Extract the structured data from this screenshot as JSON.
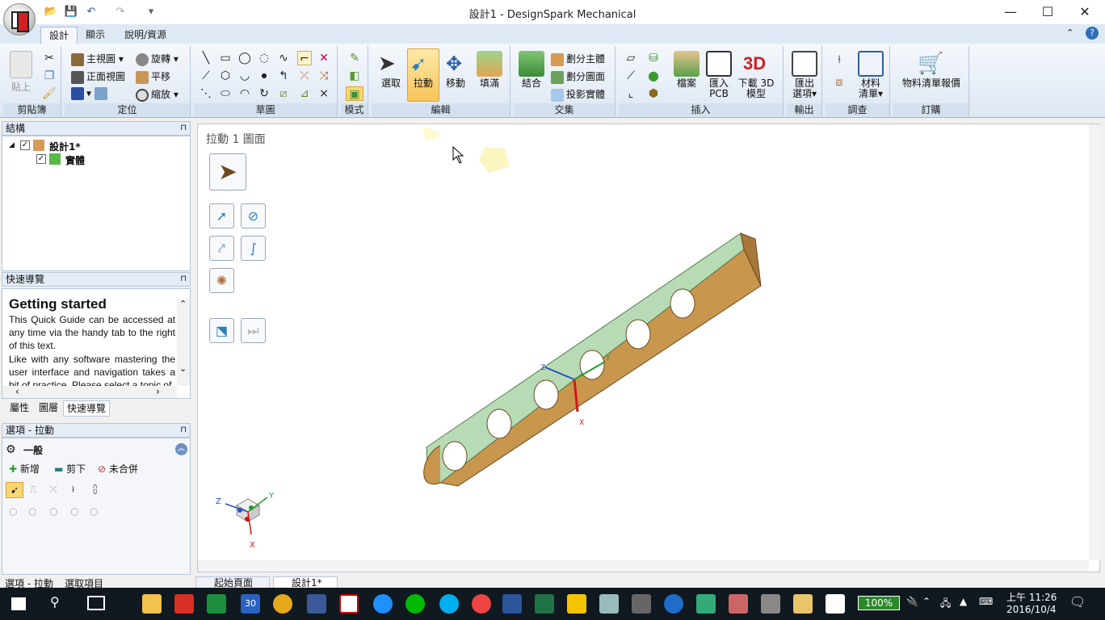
{
  "window": {
    "title": "設計1 - DesignSpark Mechanical",
    "minimize": "—",
    "maximize": "☐",
    "close": "✕"
  },
  "ribbon_tabs": [
    "設計",
    "顯示",
    "說明/資源"
  ],
  "clipboard": {
    "paste": "貼上",
    "label": "剪貼簿"
  },
  "orient": {
    "home_view": "主視圖",
    "front_view": "正面視圖",
    "rotate": "旋轉",
    "pan": "平移",
    "zoom": "縮放",
    "label": "定位"
  },
  "sketch": {
    "label": "草圖"
  },
  "mode": {
    "label": "模式"
  },
  "edit": {
    "select": "選取",
    "pull": "拉動",
    "move": "移動",
    "fill": "填滿",
    "label": "編輯"
  },
  "intersect": {
    "combine": "結合",
    "split_body": "劃分主體",
    "split_face": "劃分圖面",
    "project": "投影實體",
    "label": "交集"
  },
  "insert": {
    "file": "檔案",
    "import_pcb_1": "匯入",
    "import_pcb_2": "PCB",
    "download_3d_1": "下載 3D",
    "download_3d_2": "模型",
    "label": "插入"
  },
  "output": {
    "export_1": "匯出",
    "export_2": "選項",
    "label": "輸出"
  },
  "inspect": {
    "bom_1": "材料",
    "bom_2": "清單",
    "label": "調查"
  },
  "order": {
    "bom_quote": "物料清單報價",
    "label": "訂購"
  },
  "structure": {
    "title": "結構",
    "root": "設計1*",
    "child": "實體"
  },
  "quick_guide": {
    "title": "快速導覽",
    "heading": "Getting started",
    "p1": "This Quick Guide can be accessed at any time via the handy tab to the right of this text.",
    "p2": "Like with any software mastering the user interface and navigation takes a bit of practice. Please select a topic of"
  },
  "panel_tabs": [
    "屬性",
    "圖層",
    "快速導覽"
  ],
  "options": {
    "title": "選項 - 拉動",
    "section": "一般",
    "add": "新增",
    "cut": "剪下",
    "no_merge": "未合併"
  },
  "bottom_left_tabs": [
    "選項 - 拉動",
    "選取項目"
  ],
  "viewport": {
    "status": "拉動 1 圖面",
    "axis_x": "X",
    "axis_y": "Y",
    "axis_z": "Z"
  },
  "doc_tabs": [
    "起始頁面",
    "設計1*"
  ],
  "taskbar": {
    "battery": "100%",
    "time": "上午 11:26",
    "date": "2016/10/4",
    "calendar_day": "30"
  },
  "colors": {
    "ribbon_bg": "#dde7f3",
    "part_face": "#c9964d",
    "part_top": "#b7dbb5",
    "taskbar": "#101820"
  }
}
